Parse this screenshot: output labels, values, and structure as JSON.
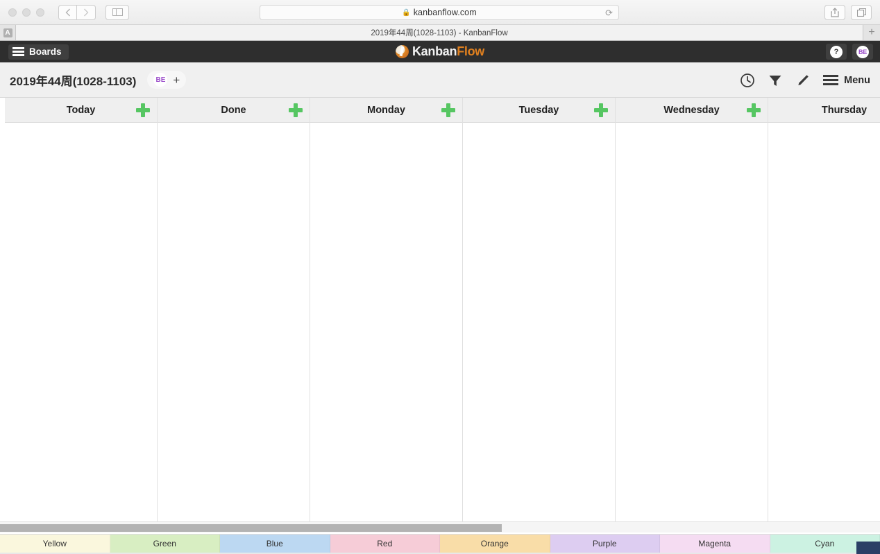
{
  "browser": {
    "url": "kanbanflow.com",
    "lock_icon": "lock-icon",
    "reload_icon": "reload-icon",
    "back_icon": "chevron-left-icon",
    "forward_icon": "chevron-right-icon",
    "sidebar_icon": "sidebar-toggle-icon",
    "share_icon": "share-icon",
    "tabs_icon": "show-tabs-icon",
    "new_tab_icon": "plus-icon",
    "tab_title": "2019年44周(1028-1103) - KanbanFlow",
    "tab_favicon_letter": "A"
  },
  "app_nav": {
    "boards_label": "Boards",
    "logo_part1": "Kanban",
    "logo_part2": "Flow",
    "help_label": "?",
    "avatar_label": "BE"
  },
  "board_header": {
    "title": "2019年44周(1028-1103)",
    "member_avatar": "BE",
    "add_member": "+",
    "menu_label": "Menu",
    "tools": [
      "clock-icon",
      "filter-icon",
      "pencil-icon"
    ]
  },
  "columns": [
    {
      "name": "Today",
      "add_label": "+"
    },
    {
      "name": "Done",
      "add_label": "+"
    },
    {
      "name": "Monday",
      "add_label": "+"
    },
    {
      "name": "Tuesday",
      "add_label": "+"
    },
    {
      "name": "Wednesday",
      "add_label": "+"
    },
    {
      "name": "Thursday",
      "add_label": "+"
    }
  ],
  "color_legend": [
    {
      "label": "Yellow",
      "color": "#faf7dd"
    },
    {
      "label": "Green",
      "color": "#d8eec2"
    },
    {
      "label": "Blue",
      "color": "#bcd8f2"
    },
    {
      "label": "Red",
      "color": "#f6ccd7"
    },
    {
      "label": "Orange",
      "color": "#f9dda8"
    },
    {
      "label": "Purple",
      "color": "#ddcdf1"
    },
    {
      "label": "Magenta",
      "color": "#f5dcf2"
    },
    {
      "label": "Cyan",
      "color": "#ccf2e2"
    }
  ],
  "scrollbar": {
    "orientation": "horizontal",
    "thumb_fraction": "0.57"
  },
  "accent_colors": {
    "add_green": "#56c662",
    "brand_orange": "#e0801f",
    "avatar_purple": "#9b4dca",
    "nav_dark": "#2e2e2e"
  }
}
